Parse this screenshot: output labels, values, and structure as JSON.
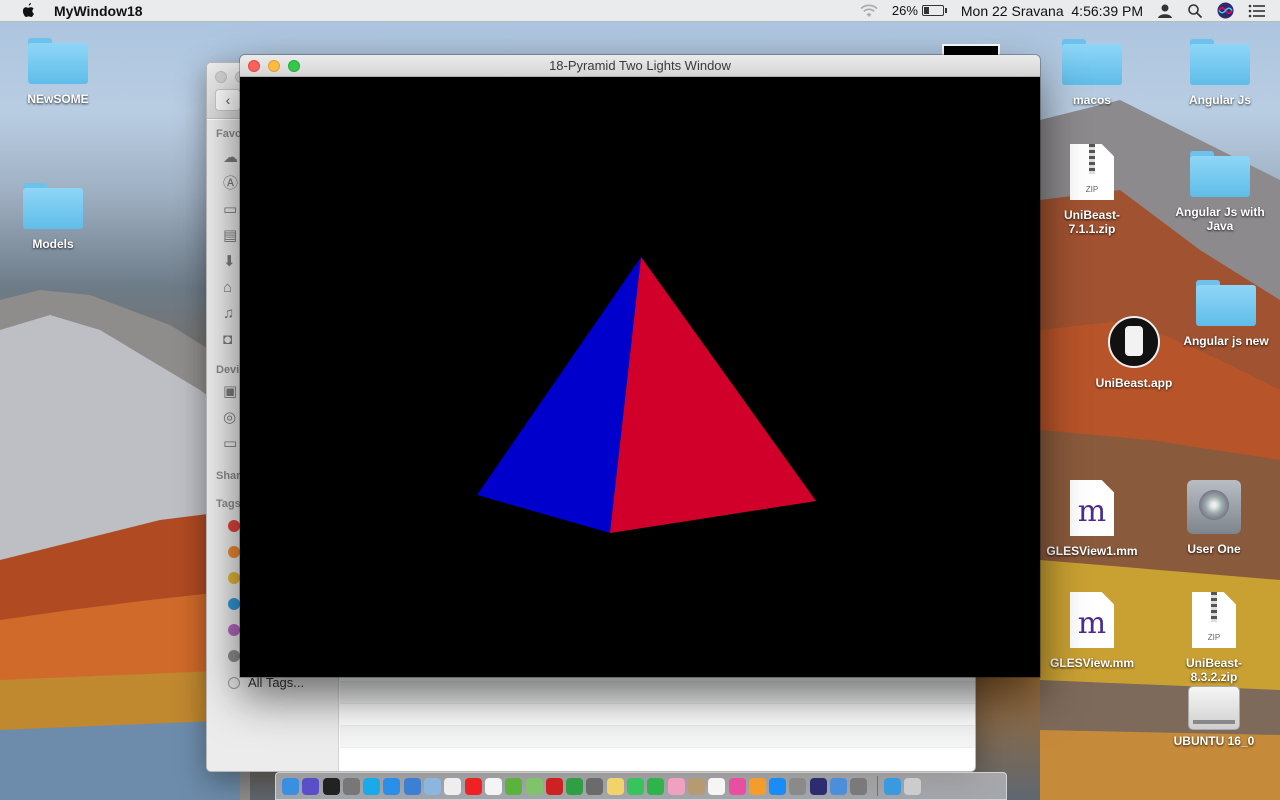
{
  "menubar": {
    "app_name": "MyWindow18",
    "battery_percent": "26%",
    "clock": "Mon 22 Sravana  4:56:39 PM",
    "icons": [
      "apple-icon",
      "wifi-icon",
      "battery-icon",
      "user-icon",
      "spotlight-icon",
      "siri-icon",
      "notification-center-icon"
    ]
  },
  "gl_window": {
    "title": "18-Pyramid Two Lights Window",
    "pyramid_colors": {
      "left_face": "#0000cc",
      "right_face": "#d1002a",
      "background": "#000000"
    }
  },
  "finder": {
    "sidebar_sections": [
      "Favo",
      "Devi",
      "Shar",
      "Tags"
    ],
    "tags": [
      {
        "color": "#e0433c"
      },
      {
        "color": "#ee8a34"
      },
      {
        "color": "#e6b63a"
      },
      {
        "color": "#2f9ad8"
      },
      {
        "color": "#b864c4"
      },
      {
        "color": "#8e8e8e"
      }
    ],
    "all_tags_label": "All Tags..."
  },
  "desktop_icons": [
    {
      "label": "NEwSOME",
      "kind": "folder"
    },
    {
      "label": "Models",
      "kind": "folder"
    },
    {
      "label": "macos",
      "kind": "folder"
    },
    {
      "label": "Angular Js",
      "kind": "folder"
    },
    {
      "label": "UniBeast-7.1.1.zip",
      "kind": "zip"
    },
    {
      "label": "Angular Js with Java",
      "kind": "folder"
    },
    {
      "label": "Angular js new",
      "kind": "folder"
    },
    {
      "label": "UniBeast.app",
      "kind": "app"
    },
    {
      "label": "GLESView1.mm",
      "kind": "mm"
    },
    {
      "label": "User One",
      "kind": "disk"
    },
    {
      "label": "GLESView.mm",
      "kind": "mm"
    },
    {
      "label": "UniBeast-8.3.2.zip",
      "kind": "zip"
    },
    {
      "label": "UBUNTU 16_0",
      "kind": "usb"
    }
  ],
  "dock": {
    "apps": [
      "finder",
      "siri",
      "terminal",
      "launchpad",
      "skype",
      "safari",
      "safari-technology-preview",
      "preview",
      "textedit",
      "youtube",
      "calendar",
      "utorrent",
      "maps",
      "photo-booth",
      "chrome",
      "dashboard",
      "notes",
      "messages",
      "facetime",
      "photos",
      "contacts",
      "reminders",
      "itunes",
      "books",
      "app-store",
      "system-preferences",
      "eclipse",
      "xcode",
      "instruments",
      "downloads",
      "trash"
    ]
  }
}
